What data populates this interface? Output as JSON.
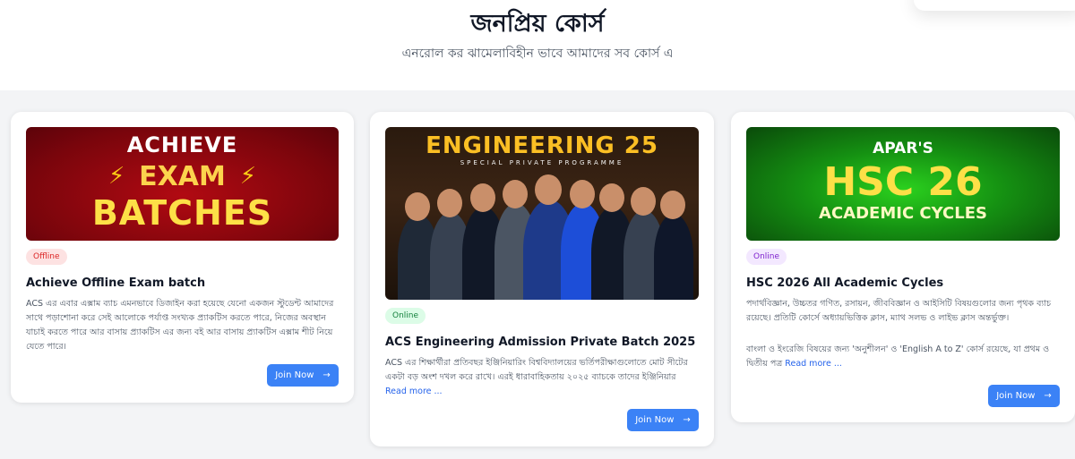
{
  "header": {
    "title": "জনপ্রিয় কোর্স",
    "subtitle": "এনরোল কর ঝামেলাবিহীন ভাবে আমাদের সব কোর্স এ"
  },
  "courses": [
    {
      "badge": "Offline",
      "title": "Achieve Offline Exam batch",
      "description": "ACS এর এবার এক্সাম ব্যাচ এমনভাবে ডিজাইন করা হয়েছে যেনো একজন স্টুডেন্ট আমাদের সাথে পড়াশোনা করে সেই আলোকে পর্যাপ্ত সংখ্যক প্র্যাকটিস করতে পারে, নিজের অবস্থান যাচাই করতে পারে আর বাসায় প্র্যাকটিস এর জন্য বই আর বাসায় প্র্যাকটিস এক্সাম শীট নিয়ে যেতে পারে।",
      "button": "Join Now",
      "banner": {
        "line1": "ACHIEVE",
        "line2": "EXAM",
        "line3": "BATCHES"
      }
    },
    {
      "badge": "Online",
      "title": "ACS Engineering Admission Private Batch 2025",
      "description": "ACS এর শিক্ষার্থীরা প্রতিবছর ইঞ্জিনিয়ারিং বিশ্ববিদ্যালয়ের ভর্তিপরীক্ষাগুলোতে মোট সীটের একটা বড় অংশ দখল করে রাখে। এরই ধারাবাহিকতায় ২০২৫ ব্যাচকে তাদের ইঞ্জিনিয়ার",
      "read_more": "Read more ...",
      "button": "Join Now",
      "banner": {
        "line1": "ENGINEERING 25",
        "line2": "SPECIAL PRIVATE PROGRAMME"
      }
    },
    {
      "badge": "Online",
      "title": "HSC 2026 All Academic Cycles",
      "description": "পদার্থবিজ্ঞান, উচ্চতর গণিত, রসায়ন, জীববিজ্ঞান ও আইসিটি বিষয়গুলোর জন্য পৃথক ব্যাচ রয়েছে। প্রতিটি কোর্সে অধ্যায়ভিত্তিক ক্লাস, ম্যাথ সলভ ও লাইভ ক্লাস অন্তর্ভুক্ত।",
      "description2": "বাংলা ও ইংরেজি বিষয়ের জন্য 'অনুশীলন' ও 'English A to Z' কোর্স রয়েছে, যা প্রথম ও দ্বিতীয় পত্র",
      "read_more": "Read more ...",
      "button": "Join Now",
      "banner": {
        "line1": "APAR'S",
        "line2": "HSC 26",
        "line3": "ACADEMIC CYCLES"
      }
    }
  ],
  "colors": {
    "button": "#3b82f6",
    "offline_badge_text": "#dc2626",
    "online_badge_green_text": "#15803d",
    "online_badge_purple_text": "#7e22ce",
    "section_bg": "#f3f4f6"
  },
  "icons": {
    "button_arrow": "arrow-right-icon",
    "bolt": "lightning-icon"
  }
}
